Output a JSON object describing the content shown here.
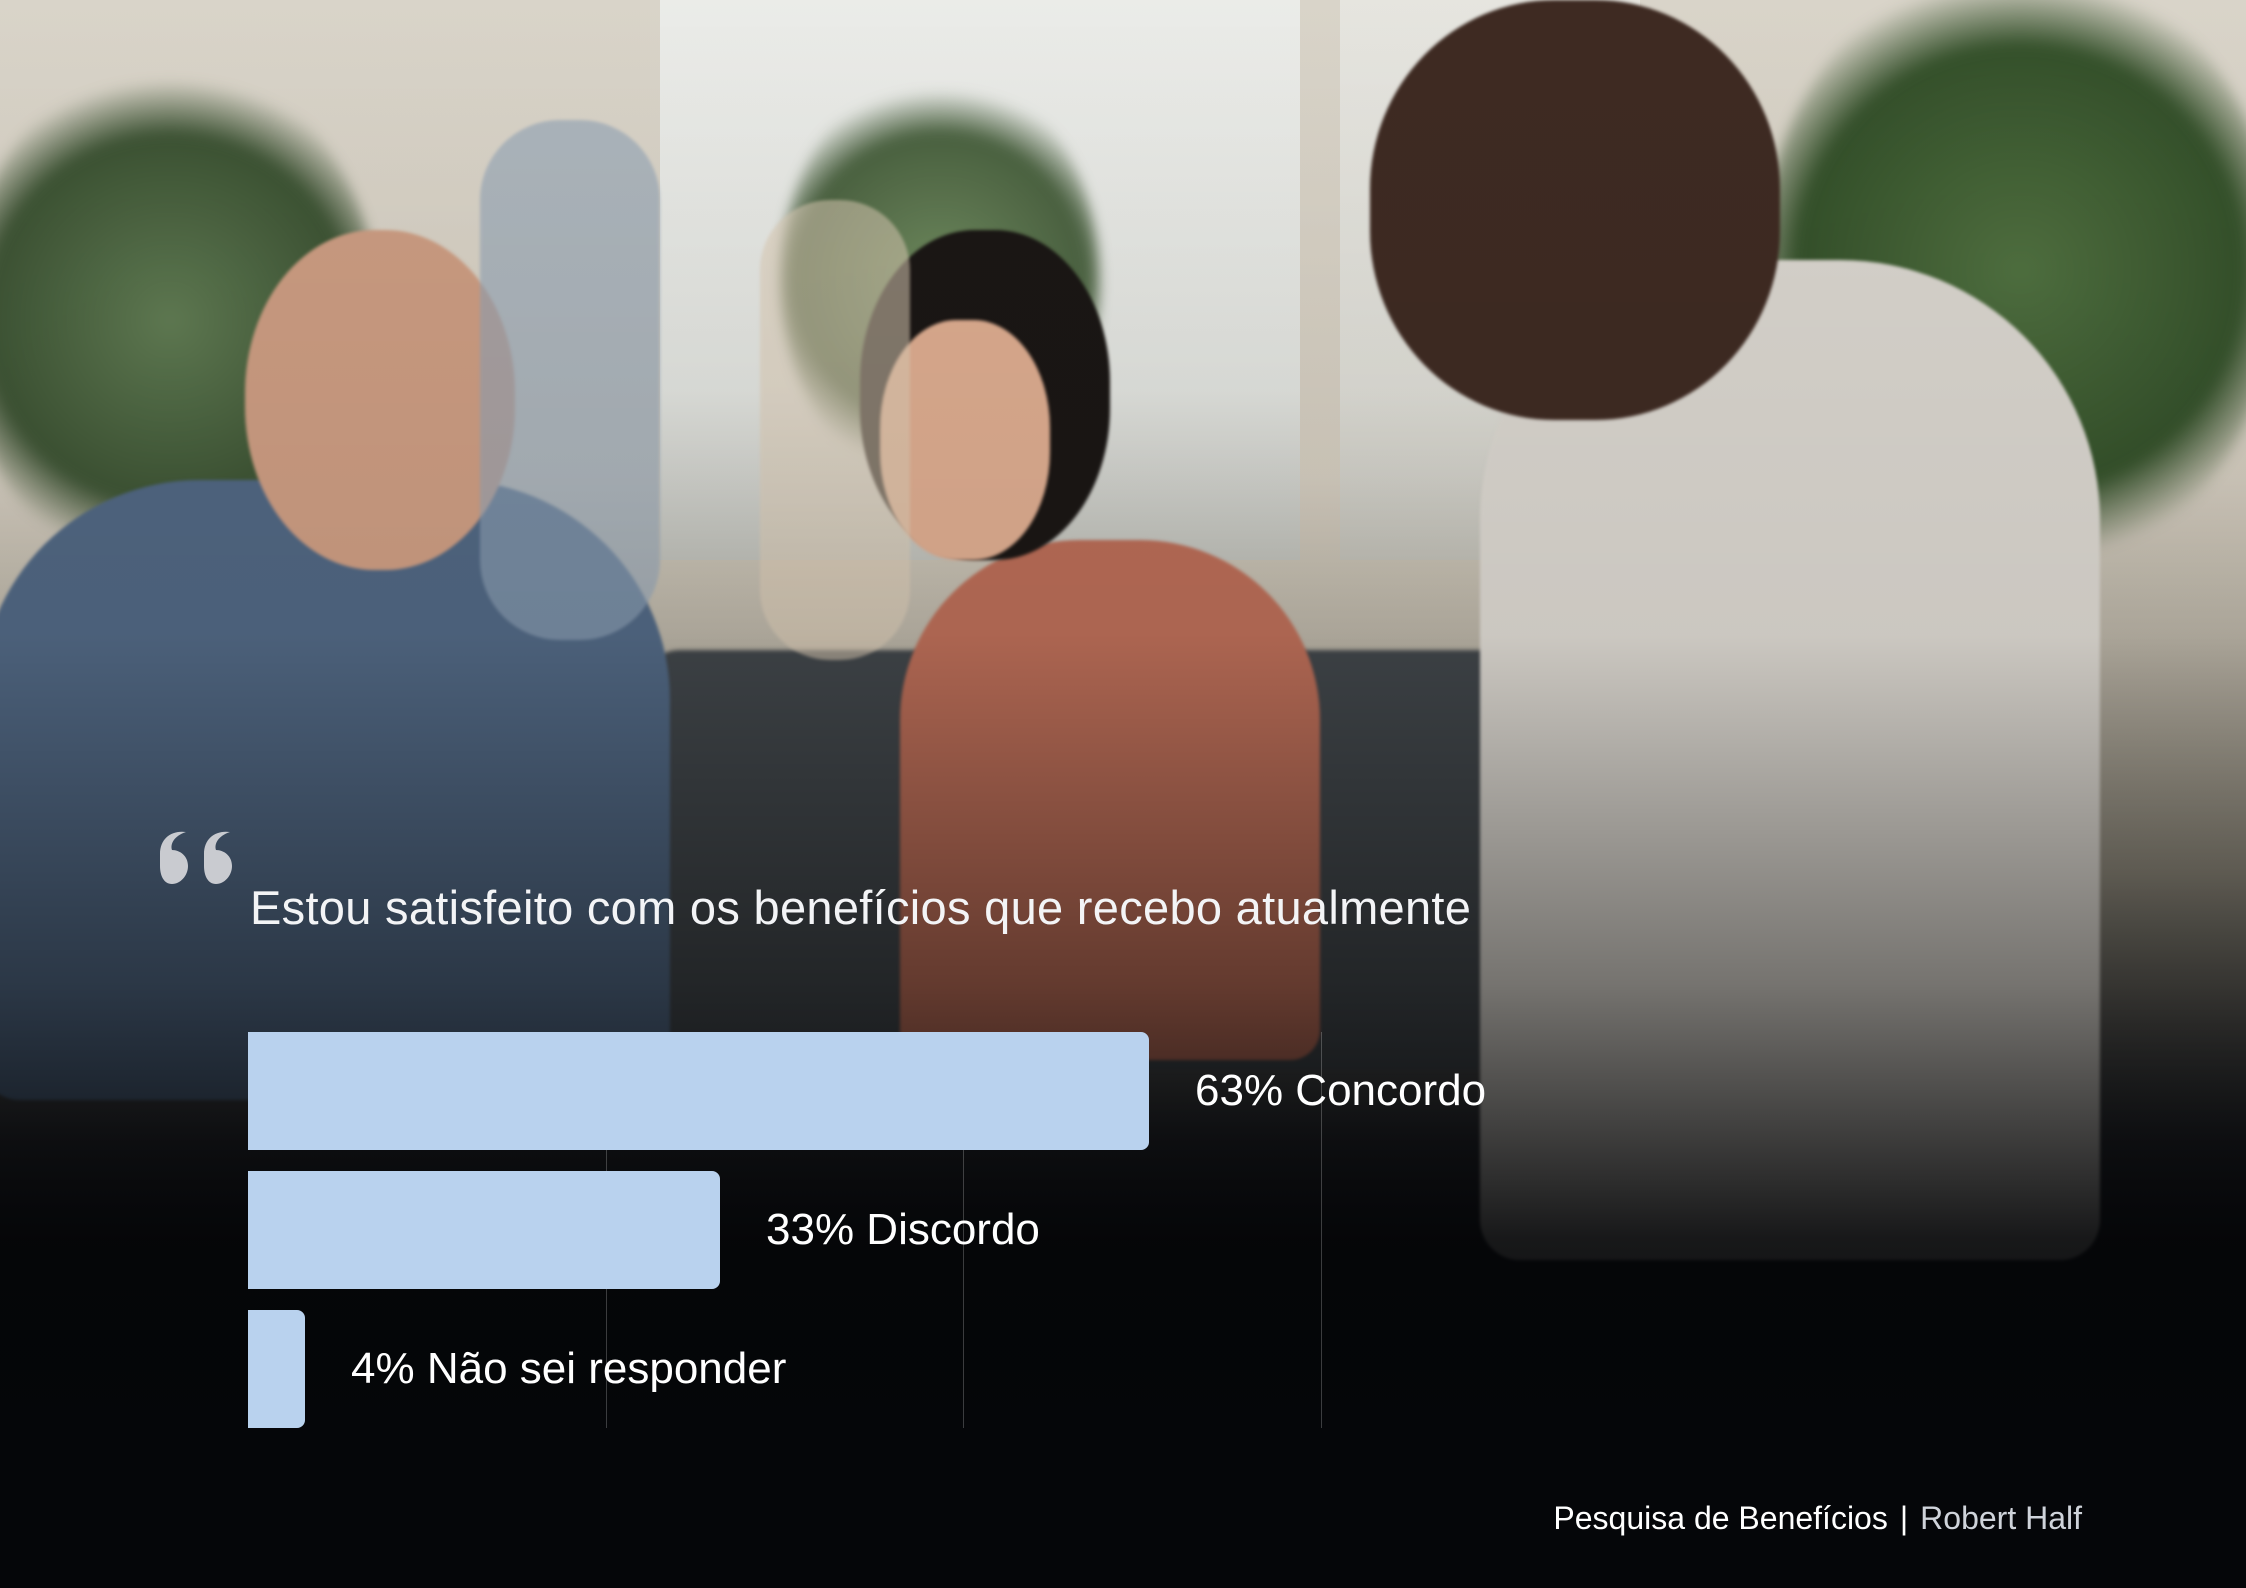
{
  "question": "Estou satisfeito com os benefícios que recebo atualmente",
  "chart_data": {
    "type": "bar",
    "orientation": "horizontal",
    "categories": [
      "Concordo",
      "Discordo",
      "Não sei responder"
    ],
    "values": [
      63,
      33,
      4
    ],
    "value_unit": "%",
    "labels": [
      "63% Concordo",
      "33% Discordo",
      "4% Não sei responder"
    ],
    "xlim": [
      0,
      100
    ],
    "grid": true,
    "bar_color": "#b9d2ee"
  },
  "footer": {
    "title": "Pesquisa de Benefícios",
    "separator": "|",
    "brand": "Robert Half"
  },
  "colors": {
    "background": "#07080b",
    "text": "#ffffff",
    "bar": "#b9d2ee"
  }
}
